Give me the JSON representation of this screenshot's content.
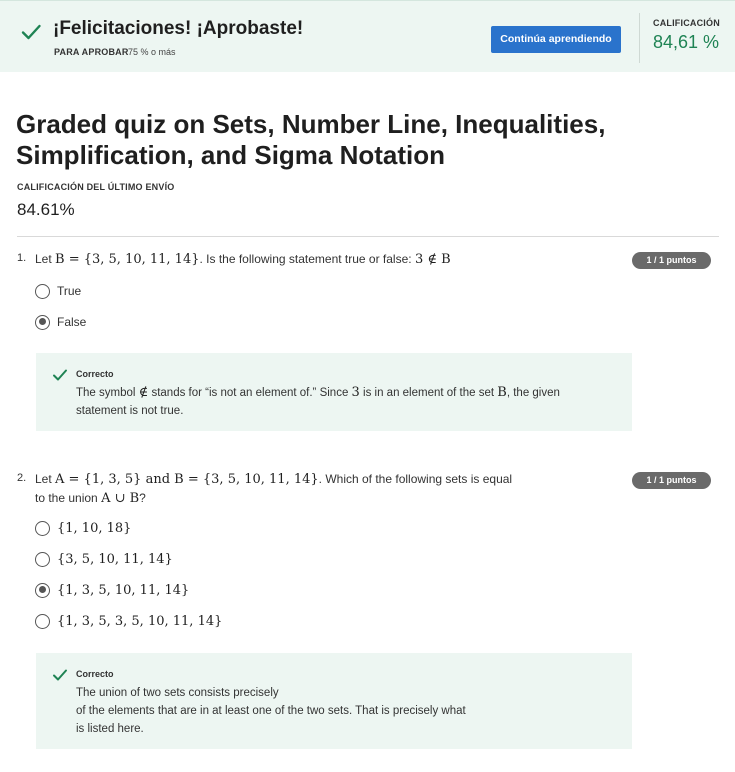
{
  "banner": {
    "title": "¡Felicitaciones! ¡Aprobaste!",
    "pass_label": "PARA APROBAR",
    "pass_value": "75 % o más",
    "continue_label": "Continúa aprendiendo",
    "grade_label": "CALIFICACIÓN",
    "grade_value": "84,61 %",
    "accent_color": "#1f8354",
    "button_color": "#2a73cc"
  },
  "header": {
    "title": "Graded quiz on Sets, Number Line, Inequalities, Simplification, and Sigma Notation",
    "last_label": "CALIFICACIÓN DEL ÚLTIMO ENVÍO",
    "last_value": "84.61%"
  },
  "questions": [
    {
      "number": "1.",
      "text_a": "Let ",
      "math_a": "B = {3, 5, 10, 11, 14}",
      "text_b": ". Is the following statement true or false: ",
      "math_b": "3 ∉ B",
      "points": "1 / 1 puntos",
      "options": [
        {
          "label": "True",
          "selected": false
        },
        {
          "label": "False",
          "selected": true
        }
      ],
      "feedback": {
        "label": "Correcto",
        "t1": "The symbol ",
        "m1": "∉",
        "t2": " stands for “is not an element of.” Since ",
        "m2": "3",
        "t3": " is in an element of the set ",
        "m3": "B",
        "t4": ", the given",
        "t5": "statement is not true."
      }
    },
    {
      "number": "2.",
      "text_a": "Let ",
      "math_a": "A = {1, 3, 5}",
      "text_and": " and ",
      "math_b": "B = {3, 5, 10, 11, 14}",
      "text_b": ". Which of the following sets is equal",
      "text_c": "to the union ",
      "math_c": "A ∪ B",
      "text_d": "?",
      "points": "1 / 1 puntos",
      "options": [
        {
          "label": "{1, 10, 18}",
          "selected": false
        },
        {
          "label": "{3, 5, 10, 11, 14}",
          "selected": false
        },
        {
          "label": "{1, 3, 5, 10, 11, 14}",
          "selected": true
        },
        {
          "label": "{1, 3, 5, 3, 5, 10, 11, 14}",
          "selected": false
        }
      ],
      "feedback": {
        "label": "Correcto",
        "line1": "The union of two sets consists precisely",
        "line2": "of the elements that are in at least one of the two sets. That is precisely what",
        "line3": "is listed here."
      }
    }
  ]
}
